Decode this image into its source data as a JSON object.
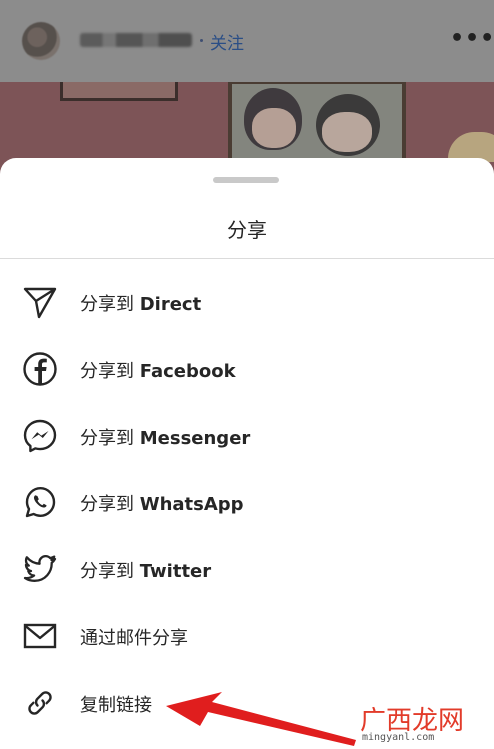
{
  "post_header": {
    "follow_label": "关注",
    "more_label": "•••"
  },
  "share_sheet": {
    "title": "分享",
    "items": [
      {
        "prefix": "分享到 ",
        "target": "Direct",
        "icon": "send-icon"
      },
      {
        "prefix": "分享到 ",
        "target": "Facebook",
        "icon": "facebook-icon"
      },
      {
        "prefix": "分享到 ",
        "target": "Messenger",
        "icon": "messenger-icon"
      },
      {
        "prefix": "分享到 ",
        "target": "WhatsApp",
        "icon": "whatsapp-icon"
      },
      {
        "prefix": "分享到 ",
        "target": "Twitter",
        "icon": "twitter-icon"
      },
      {
        "prefix": "通过邮件分享",
        "target": "",
        "icon": "mail-icon"
      },
      {
        "prefix": "复制链接",
        "target": "",
        "icon": "link-icon"
      }
    ]
  },
  "watermark": {
    "brand": "广西龙网",
    "url": "mingyanl.com"
  },
  "colors": {
    "follow_link": "#2a4e86",
    "annotation_arrow": "#e01e1e",
    "text": "#262626"
  }
}
